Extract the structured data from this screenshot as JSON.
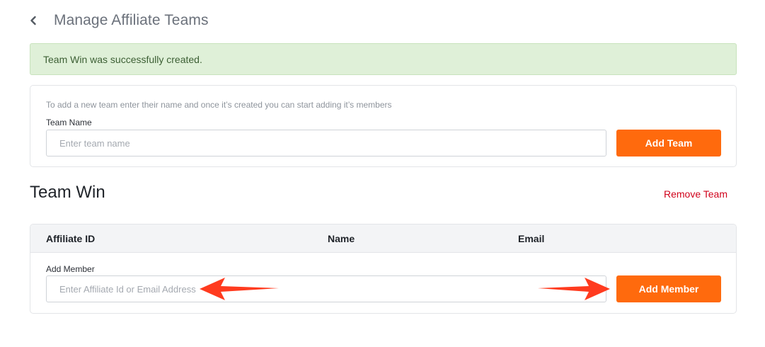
{
  "header": {
    "title": "Manage Affiliate Teams",
    "back_icon": "chevron-left-icon"
  },
  "alert": {
    "message": "Team Win was successfully created.",
    "color": "#dff0d8"
  },
  "create_team": {
    "helper_text": "To add a new team enter their name and once it’s created you can start adding it’s members",
    "label": "Team Name",
    "placeholder": "Enter team name",
    "value": "",
    "button_label": "Add Team"
  },
  "team": {
    "name": "Team Win",
    "remove_label": "Remove Team",
    "columns": [
      "Affiliate ID",
      "Name",
      "Email"
    ],
    "add_member": {
      "label": "Add Member",
      "placeholder": "Enter Affiliate Id or Email Address",
      "value": "",
      "button_label": "Add Member"
    }
  },
  "colors": {
    "accent": "#ff6a0d",
    "danger": "#d0021b",
    "annotation_arrow": "#ff3b1f"
  }
}
